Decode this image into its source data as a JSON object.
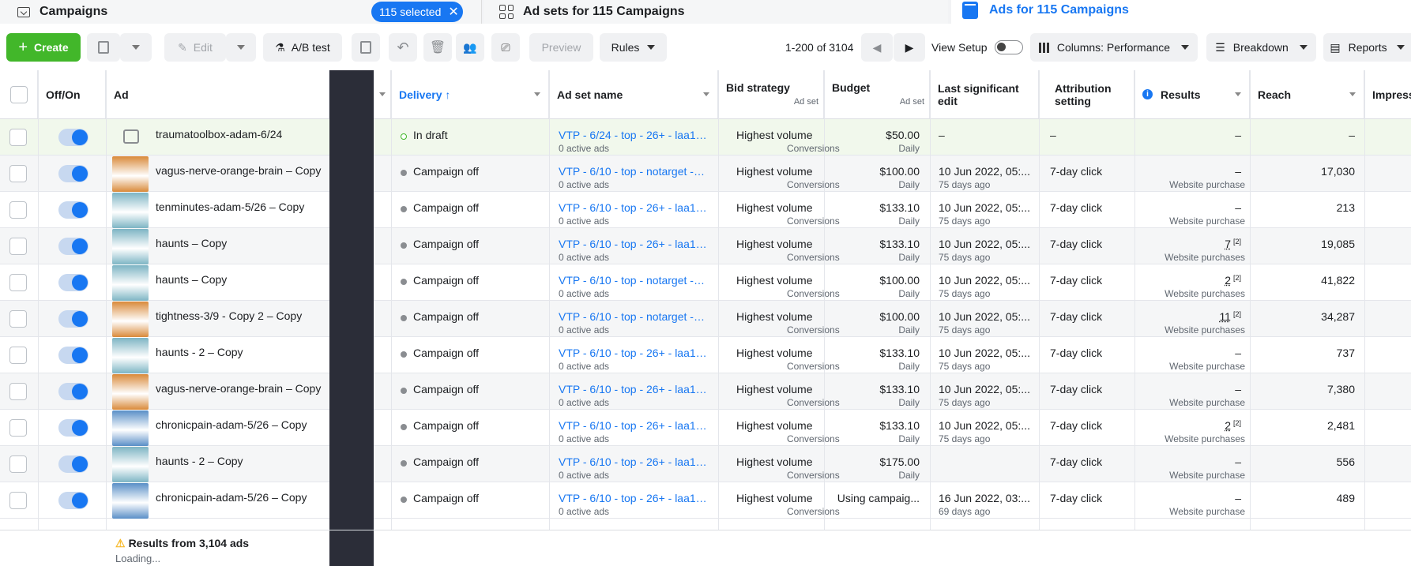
{
  "tabs": {
    "campaigns": "Campaigns",
    "selected": "115 selected",
    "adsets": "Ad sets for 115 Campaigns",
    "ads": "Ads for 115 Campaigns"
  },
  "toolbar": {
    "create": "Create",
    "edit": "Edit",
    "ab_test": "A/B test",
    "preview": "Preview",
    "rules": "Rules",
    "pager": "1-200 of 3104",
    "view_setup": "View Setup",
    "columns": "Columns: Performance",
    "breakdown": "Breakdown",
    "reports": "Reports"
  },
  "headers": {
    "offon": "Off/On",
    "ad": "Ad",
    "delivery": "Delivery ↑",
    "adset_name": "Ad set name",
    "bid_strategy": "Bid strategy",
    "bid_sub": "Ad set",
    "budget": "Budget",
    "budget_sub": "Ad set",
    "last_edit": "Last significant edit",
    "attribution": "Attribution setting",
    "results": "Results",
    "reach": "Reach",
    "impressions": "Impress"
  },
  "rows": [
    {
      "name": "traumatoolbox-adam-6/24",
      "delivery": "In draft",
      "adset": "VTP - 6/24 - top - 26+ - laa10...",
      "adset_sub": "0 active ads",
      "bid": "Highest volume",
      "bid_sub": "Conversions",
      "budget": "$50.00",
      "budget_sub": "Daily",
      "edit": "–",
      "edit_sub": "",
      "attr": "–",
      "results": "–",
      "results_sub": "",
      "reach": "–"
    },
    {
      "name": "vagus-nerve-orange-brain – Copy",
      "delivery": "Campaign off",
      "adset": "VTP - 6/10 - top - notarget - s...",
      "adset_sub": "0 active ads",
      "bid": "Highest volume",
      "bid_sub": "Conversions",
      "budget": "$100.00",
      "budget_sub": "Daily",
      "edit": "10 Jun 2022, 05:...",
      "edit_sub": "75 days ago",
      "attr": "7-day click",
      "results": "–",
      "results_sub": "Website purchase",
      "reach": "17,030"
    },
    {
      "name": "tenminutes-adam-5/26 – Copy",
      "delivery": "Campaign off",
      "adset": "VTP - 6/10 - top - 26+ - laa10...",
      "adset_sub": "0 active ads",
      "bid": "Highest volume",
      "bid_sub": "Conversions",
      "budget": "$133.10",
      "budget_sub": "Daily",
      "edit": "10 Jun 2022, 05:...",
      "edit_sub": "75 days ago",
      "attr": "7-day click",
      "results": "–",
      "results_sub": "Website purchase",
      "reach": "213"
    },
    {
      "name": "haunts – Copy",
      "delivery": "Campaign off",
      "adset": "VTP - 6/10 - top - 26+ - laa10...",
      "adset_sub": "0 active ads",
      "bid": "Highest volume",
      "bid_sub": "Conversions",
      "budget": "$133.10",
      "budget_sub": "Daily",
      "edit": "10 Jun 2022, 05:...",
      "edit_sub": "75 days ago",
      "attr": "7-day click",
      "results": "7",
      "results_sup": "[2]",
      "results_sub": "Website purchases",
      "reach": "19,085"
    },
    {
      "name": "haunts – Copy",
      "delivery": "Campaign off",
      "adset": "VTP - 6/10 - top - notarget - s...",
      "adset_sub": "0 active ads",
      "bid": "Highest volume",
      "bid_sub": "Conversions",
      "budget": "$100.00",
      "budget_sub": "Daily",
      "edit": "10 Jun 2022, 05:...",
      "edit_sub": "75 days ago",
      "attr": "7-day click",
      "results": "2",
      "results_sup": "[2]",
      "results_sub": "Website purchases",
      "reach": "41,822"
    },
    {
      "name": "tightness-3/9 - Copy 2 – Copy",
      "delivery": "Campaign off",
      "adset": "VTP - 6/10 - top - notarget - s...",
      "adset_sub": "0 active ads",
      "bid": "Highest volume",
      "bid_sub": "Conversions",
      "budget": "$100.00",
      "budget_sub": "Daily",
      "edit": "10 Jun 2022, 05:...",
      "edit_sub": "75 days ago",
      "attr": "7-day click",
      "results": "11",
      "results_sup": "[2]",
      "results_sub": "Website purchases",
      "reach": "34,287"
    },
    {
      "name": "haunts - 2 – Copy",
      "delivery": "Campaign off",
      "adset": "VTP - 6/10 - top - 26+ - laa10...",
      "adset_sub": "0 active ads",
      "bid": "Highest volume",
      "bid_sub": "Conversions",
      "budget": "$133.10",
      "budget_sub": "Daily",
      "edit": "10 Jun 2022, 05:...",
      "edit_sub": "75 days ago",
      "attr": "7-day click",
      "results": "–",
      "results_sub": "Website purchase",
      "reach": "737"
    },
    {
      "name": "vagus-nerve-orange-brain – Copy",
      "delivery": "Campaign off",
      "adset": "VTP - 6/10 - top - 26+ - laa10...",
      "adset_sub": "0 active ads",
      "bid": "Highest volume",
      "bid_sub": "Conversions",
      "budget": "$133.10",
      "budget_sub": "Daily",
      "edit": "10 Jun 2022, 05:...",
      "edit_sub": "75 days ago",
      "attr": "7-day click",
      "results": "–",
      "results_sub": "Website purchase",
      "reach": "7,380"
    },
    {
      "name": "chronicpain-adam-5/26 – Copy",
      "delivery": "Campaign off",
      "adset": "VTP - 6/10 - top - 26+ - laa10...",
      "adset_sub": "0 active ads",
      "bid": "Highest volume",
      "bid_sub": "Conversions",
      "budget": "$133.10",
      "budget_sub": "Daily",
      "edit": "10 Jun 2022, 05:...",
      "edit_sub": "75 days ago",
      "attr": "7-day click",
      "results": "2",
      "results_sup": "[2]",
      "results_sub": "Website purchases",
      "reach": "2,481"
    },
    {
      "name": "haunts - 2 – Copy",
      "delivery": "Campaign off",
      "adset": "VTP - 6/10 - top - 26+ - laa10...",
      "adset_sub": "0 active ads",
      "bid": "Highest volume",
      "bid_sub": "Conversions",
      "budget": "$175.00",
      "budget_sub": "Daily",
      "edit": "",
      "edit_sub": "",
      "attr": "7-day click",
      "results": "–",
      "results_sub": "Website purchase",
      "reach": "556"
    },
    {
      "name": "chronicpain-adam-5/26 – Copy",
      "delivery": "Campaign off",
      "adset": "VTP - 6/10 - top - 26+ - laa10...",
      "adset_sub": "0 active ads",
      "bid": "Highest volume",
      "bid_sub": "Conversions",
      "budget": "Using campaig...",
      "budget_sub": "",
      "edit": "16 Jun 2022, 03:...",
      "edit_sub": "69 days ago",
      "attr": "7-day click",
      "results": "–",
      "results_sub": "Website purchase",
      "reach": "489"
    }
  ],
  "footer": {
    "warning": "Results from 3,104 ads",
    "loading": "Loading..."
  },
  "colors": {
    "accent": "#1877f2",
    "create": "#42b72a",
    "draft_row": "#f1f8ec",
    "thumb_orange": "#d98a3a",
    "thumb_teal": "#7db5c4",
    "thumb_blue": "#5a8fc7"
  }
}
